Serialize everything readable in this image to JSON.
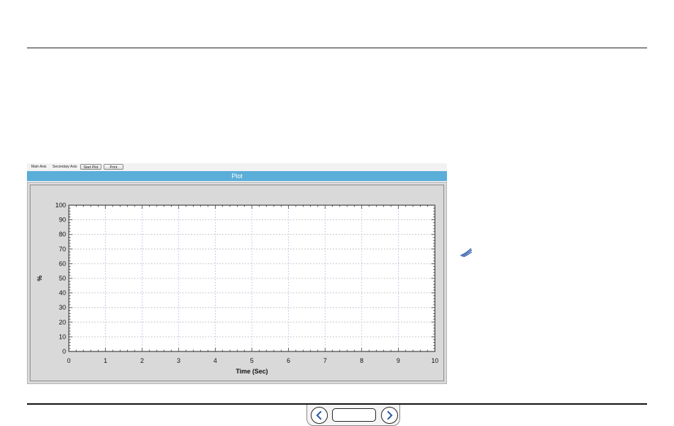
{
  "toolbar": {
    "main_axis": "Main Axis",
    "secondary_axis": "Secondary Axis",
    "start_plot": "Start Plot",
    "print": "Print"
  },
  "plot": {
    "title": "Plot"
  },
  "chart_data": {
    "type": "line",
    "title": "Plot",
    "xlabel": "Time (Sec)",
    "ylabel": "%",
    "xlim": [
      0,
      10
    ],
    "ylim": [
      0,
      100
    ],
    "xticks": [
      0,
      1,
      2,
      3,
      4,
      5,
      6,
      7,
      8,
      9,
      10
    ],
    "yticks": [
      0,
      10,
      20,
      30,
      40,
      50,
      60,
      70,
      80,
      90,
      100
    ],
    "series": [],
    "grid": true
  },
  "icons": {
    "side": "swoosh-icon",
    "prev": "chevron-left-icon",
    "next": "chevron-right-icon"
  },
  "colors": {
    "title_bar": "#5aaed8",
    "grid_v": "#b9bfe8",
    "grid_h": "#bcbcbc"
  }
}
